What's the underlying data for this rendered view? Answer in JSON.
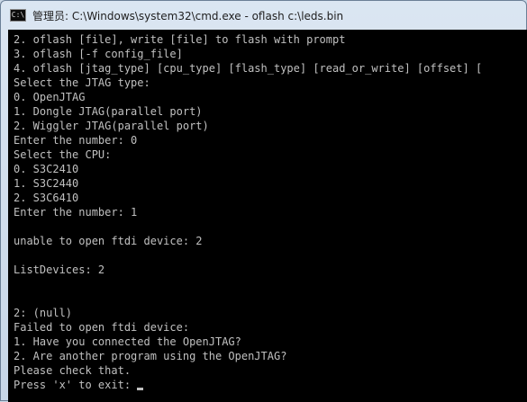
{
  "window": {
    "title": "管理员: C:\\Windows\\system32\\cmd.exe - oflash  c:\\leds.bin",
    "icon": "cmd-icon"
  },
  "console": {
    "lines": [
      "2. oflash [file], write [file] to flash with prompt",
      "3. oflash [-f config_file]",
      "4. oflash [jtag_type] [cpu_type] [flash_type] [read_or_write] [offset] [",
      "Select the JTAG type:",
      "0. OpenJTAG",
      "1. Dongle JTAG(parallel port)",
      "2. Wiggler JTAG(parallel port)",
      "Enter the number: 0",
      "Select the CPU:",
      "0. S3C2410",
      "1. S3C2440",
      "2. S3C6410",
      "Enter the number: 1",
      "",
      "unable to open ftdi device: 2",
      "",
      "ListDevices: 2",
      "",
      "",
      "2: (null)",
      "Failed to open ftdi device:",
      "1. Have you connected the OpenJTAG?",
      "2. Are another program using the OpenJTAG?",
      "Please check that.",
      "Press 'x' to exit: "
    ]
  }
}
